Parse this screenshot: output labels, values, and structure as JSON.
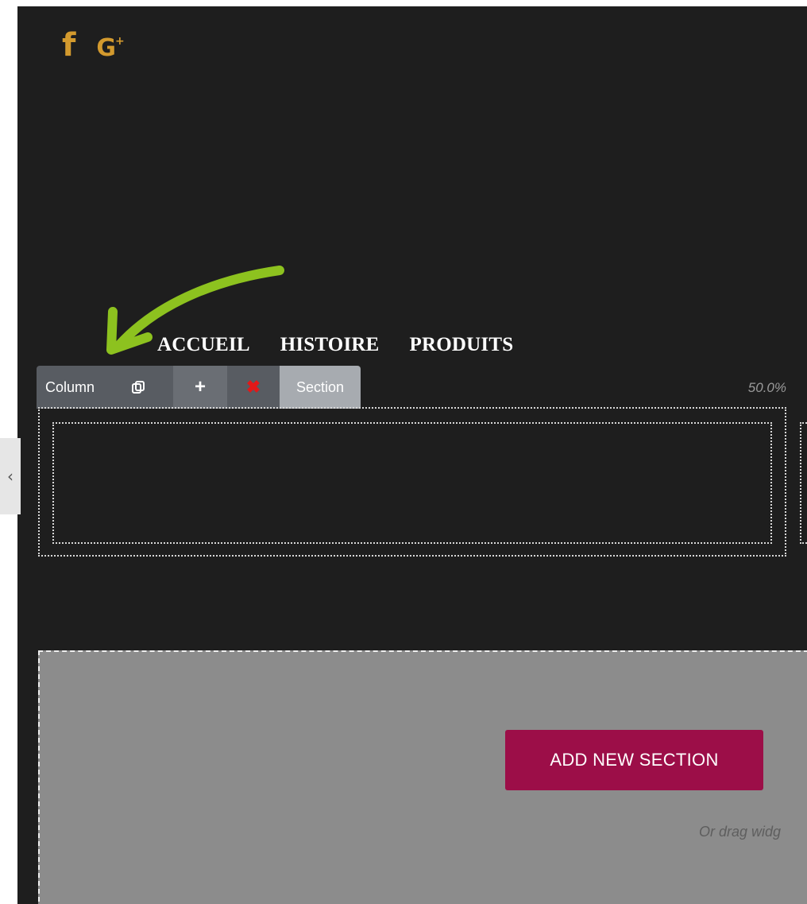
{
  "social": {
    "facebook_glyph": "f",
    "google_plus_glyph": "G",
    "google_plus_sup": "+",
    "color": "#d39a2e"
  },
  "nav": {
    "items": [
      "ACCUEIL",
      "HISTOIRE",
      "PRODUITS"
    ]
  },
  "column_toolbar": {
    "label": "Column",
    "duplicate_icon": "duplicate-icon",
    "add_glyph": "+",
    "delete_glyph": "✖",
    "section_label": "Section"
  },
  "column_width": "50.0%",
  "collapse_glyph": "‹",
  "drop_zone": {
    "button_label": "ADD NEW SECTION",
    "hint": "Or drag widg"
  },
  "colors": {
    "canvas_bg": "#1e1e1e",
    "arrow": "#8dc21f",
    "add_section_button": "#9c0e48",
    "drop_zone_bg": "#8c8c8c"
  }
}
